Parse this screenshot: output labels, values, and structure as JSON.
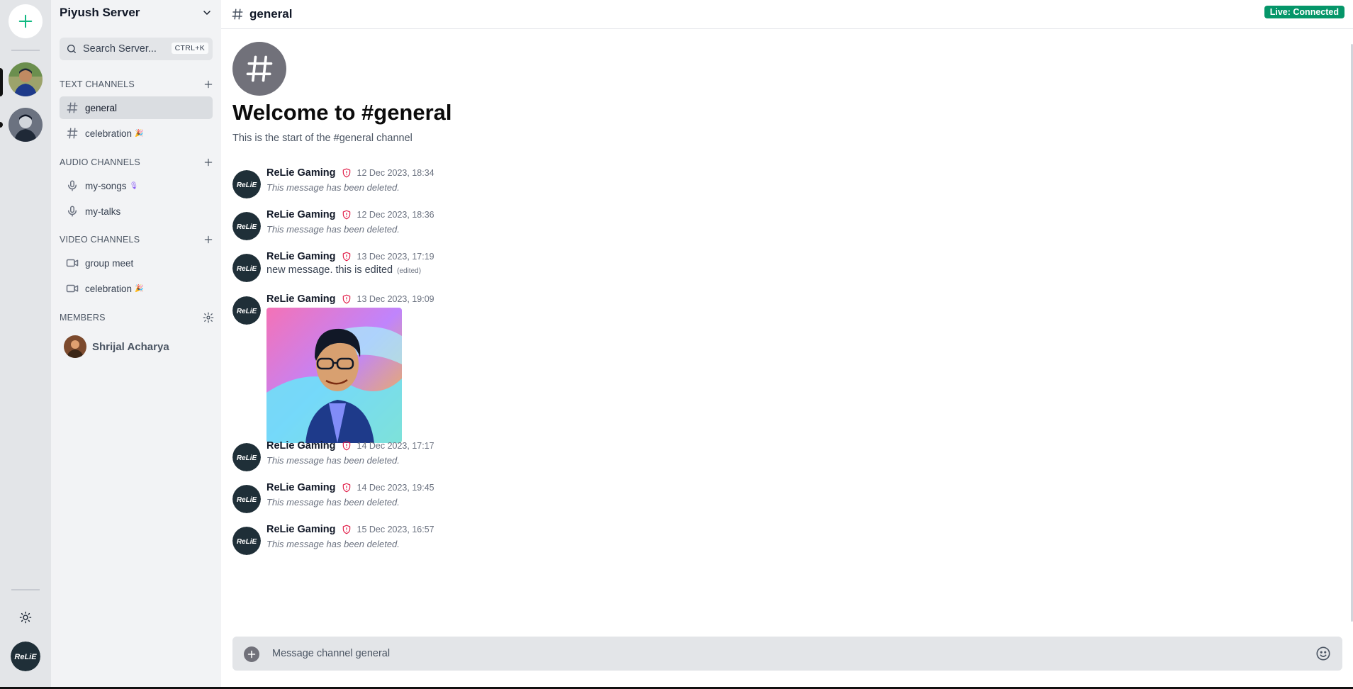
{
  "rail": {
    "add_label": "+",
    "servers": [
      {
        "name": "server-1",
        "color": "#6b7280"
      },
      {
        "name": "server-2",
        "color": "#4b5563"
      }
    ]
  },
  "sidebar": {
    "server_name": "Piyush Server",
    "search": {
      "label": "Search Server...",
      "shortcut": "CTRL+K"
    },
    "text_channels": {
      "title": "TEXT CHANNELS",
      "items": [
        {
          "label": "general",
          "emoji": ""
        },
        {
          "label": "celebration",
          "emoji": "🎉"
        }
      ]
    },
    "audio_channels": {
      "title": "AUDIO CHANNELS",
      "items": [
        {
          "label": "my-songs",
          "emoji": "🎙"
        },
        {
          "label": "my-talks",
          "emoji": ""
        }
      ]
    },
    "video_channels": {
      "title": "VIDEO CHANNELS",
      "items": [
        {
          "label": "group meet",
          "emoji": ""
        },
        {
          "label": "celebration",
          "emoji": "🎉"
        }
      ]
    },
    "members": {
      "title": "MEMBERS",
      "items": [
        {
          "name": "Shrijal Acharya"
        }
      ]
    }
  },
  "topbar": {
    "channel_name": "general",
    "status": "Live: Connected"
  },
  "welcome": {
    "title": "Welcome to #general",
    "subtitle": "This is the start of the #general channel"
  },
  "messages": [
    {
      "author": "ReLie Gaming",
      "time": "12 Dec 2023, 18:34",
      "body": "This message has been deleted.",
      "deleted": true
    },
    {
      "author": "ReLie Gaming",
      "time": "12 Dec 2023, 18:36",
      "body": "This message has been deleted.",
      "deleted": true
    },
    {
      "author": "ReLie Gaming",
      "time": "13 Dec 2023, 17:19",
      "body": "new message. this is edited",
      "edited_tag": "(edited)",
      "deleted": false
    },
    {
      "author": "ReLie Gaming",
      "time": "13 Dec 2023, 19:09",
      "image": true
    },
    {
      "author": "ReLie Gaming",
      "time": "14 Dec 2023, 17:17",
      "body": "This message has been deleted.",
      "deleted": true
    },
    {
      "author": "ReLie Gaming",
      "time": "14 Dec 2023, 19:45",
      "body": "This message has been deleted.",
      "deleted": true
    },
    {
      "author": "ReLie Gaming",
      "time": "15 Dec 2023, 16:57",
      "body": "This message has been deleted.",
      "deleted": true
    }
  ],
  "composer": {
    "placeholder": "Message channel general"
  },
  "colors": {
    "accent": "#10b981",
    "live_badge": "#059669",
    "moderator_shield": "#e11d48"
  },
  "icons": {
    "add_server": "plus-icon",
    "chevron": "chevron-down-icon",
    "search": "search-icon",
    "text_channel": "hash-icon",
    "audio_channel": "mic-icon",
    "video_channel": "video-icon",
    "members_settings": "gear-icon",
    "theme": "sun-icon",
    "moderator": "shield-alert-icon",
    "emoji": "smile-icon"
  }
}
